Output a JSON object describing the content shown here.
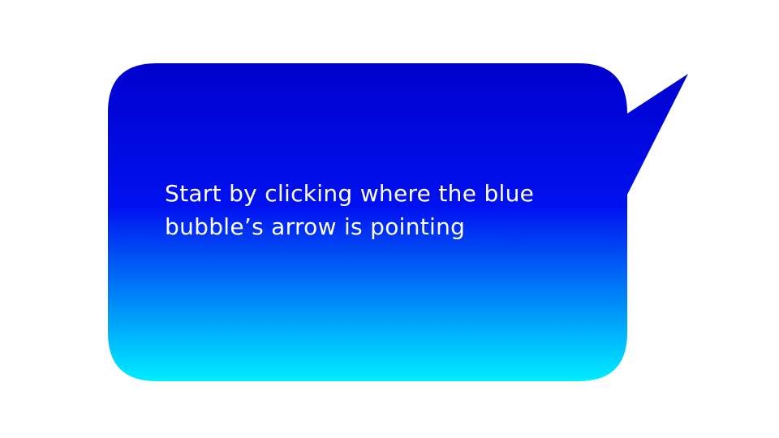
{
  "speech_bubble": {
    "text_lines": [
      "Start by clicking where the blue",
      "bubble’s arrow is pointing"
    ],
    "gradient": {
      "top_color": "#0000CC",
      "middle_color": "#0011F0",
      "bottom_color": "#00EEFF"
    },
    "text_color": "#FFFFFF",
    "pointer_direction": "top-right"
  }
}
